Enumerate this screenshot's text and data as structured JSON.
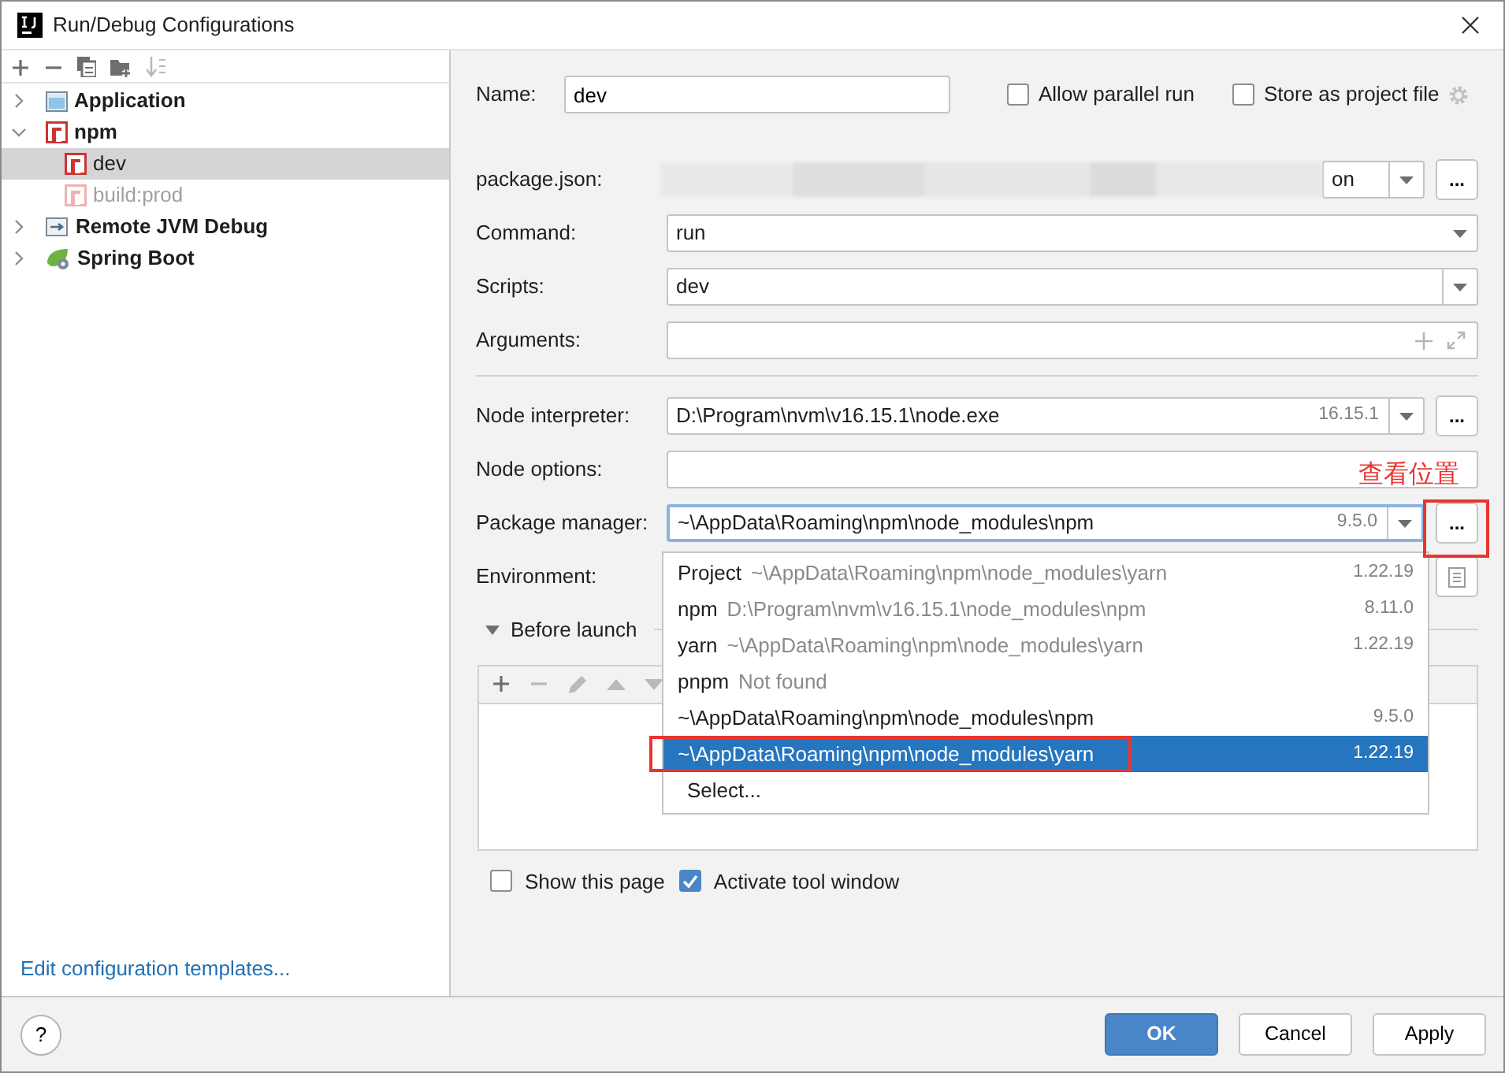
{
  "window": {
    "title": "Run/Debug Configurations"
  },
  "toolbar": [
    {
      "kind": "add",
      "disabled": false
    },
    {
      "kind": "remove",
      "disabled": false
    },
    {
      "kind": "copy",
      "disabled": false
    },
    {
      "kind": "folder",
      "disabled": false
    },
    {
      "kind": "sort",
      "disabled": true
    }
  ],
  "tree": [
    {
      "label": "Application",
      "kind": "application",
      "expanded": false,
      "selected": false
    },
    {
      "label": "npm",
      "kind": "npm",
      "expanded": true,
      "selected": false,
      "children": [
        {
          "label": "dev",
          "kind": "npm",
          "selected": true,
          "disabled": false
        },
        {
          "label": "build:prod",
          "kind": "npm",
          "selected": false,
          "disabled": true
        }
      ]
    },
    {
      "label": "Remote JVM Debug",
      "kind": "remote",
      "expanded": false,
      "selected": false
    },
    {
      "label": "Spring Boot",
      "kind": "spring",
      "expanded": false,
      "selected": false
    }
  ],
  "templates_link": "Edit configuration templates...",
  "form": {
    "name": {
      "label": "Name:",
      "value": "dev"
    },
    "options": [
      {
        "label": "Allow parallel run",
        "checked": false
      },
      {
        "label": "Store as project file",
        "checked": false,
        "gear": true
      }
    ],
    "sections": [
      [
        {
          "label": "package.json:",
          "kind": "blurred",
          "value": "on",
          "browse": "..."
        },
        {
          "label": "Command:",
          "kind": "select",
          "value": "run"
        },
        {
          "label": "Scripts:",
          "kind": "combo",
          "value": "dev"
        },
        {
          "label": "Arguments:",
          "kind": "expand"
        }
      ],
      [
        {
          "label": "Node interpreter:",
          "kind": "select",
          "value": "D:\\Program\\nvm\\v16.15.1\\node.exe",
          "version": "16.15.1",
          "browse": "..."
        },
        {
          "label": "Node options:",
          "kind": "text"
        },
        {
          "label": "Package manager:",
          "kind": "select",
          "value": "~\\AppData\\Roaming\\npm\\node_modules\\npm",
          "version": "9.5.0",
          "browse": "...",
          "focused": true
        },
        {
          "label": "Environment:",
          "kind": "env"
        }
      ]
    ],
    "before_launch": {
      "label": "Before launch",
      "expanded": true,
      "tools": [
        {
          "kind": "add",
          "disabled": false
        },
        {
          "kind": "remove",
          "disabled": true
        },
        {
          "kind": "edit",
          "disabled": true
        },
        {
          "kind": "up",
          "disabled": true
        },
        {
          "kind": "down",
          "disabled": true
        }
      ]
    },
    "checks": [
      {
        "label": "Show this page",
        "checked": false
      },
      {
        "label": "Activate tool window",
        "checked": true
      }
    ]
  },
  "dropdown": [
    {
      "kind": "named",
      "name": "Project",
      "path": "~\\AppData\\Roaming\\npm\\node_modules\\yarn",
      "version": "1.22.19",
      "selected": false
    },
    {
      "kind": "named",
      "name": "npm",
      "path": "D:\\Program\\nvm\\v16.15.1\\node_modules\\npm",
      "version": "8.11.0",
      "selected": false
    },
    {
      "kind": "named",
      "name": "yarn",
      "path": "~\\AppData\\Roaming\\npm\\node_modules\\yarn",
      "version": "1.22.19",
      "selected": false
    },
    {
      "kind": "named",
      "name": "pnpm",
      "path": "Not found",
      "selected": false
    },
    {
      "kind": "path",
      "path": "~\\AppData\\Roaming\\npm\\node_modules\\npm",
      "version": "9.5.0",
      "selected": false
    },
    {
      "kind": "path",
      "path": "~\\AppData\\Roaming\\npm\\node_modules\\yarn",
      "version": "1.22.19",
      "selected": true
    },
    {
      "kind": "action",
      "path": "Select...",
      "selected": false
    }
  ],
  "annotation": {
    "text": "查看位置"
  },
  "footer": {
    "help": "?",
    "buttons": [
      {
        "label": "OK",
        "primary": true
      },
      {
        "label": "Cancel",
        "primary": false
      },
      {
        "label": "Apply",
        "primary": false
      }
    ]
  }
}
